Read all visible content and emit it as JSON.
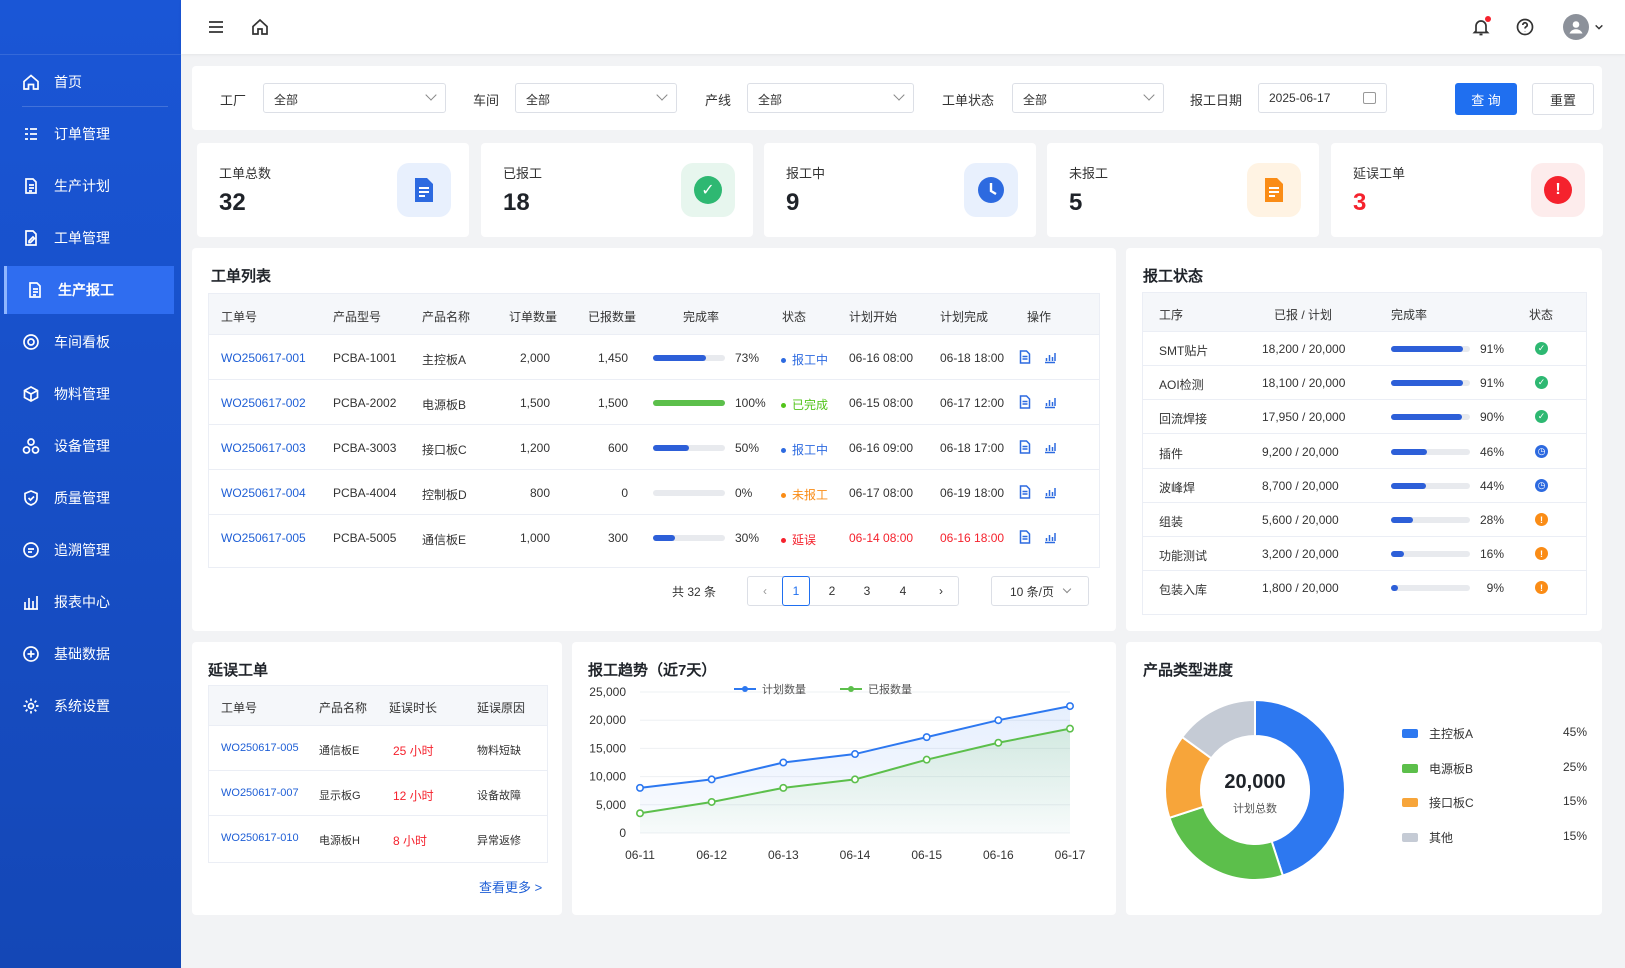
{
  "sidebar": {
    "items": [
      {
        "label": "首页",
        "icon": "home-icon"
      },
      {
        "label": "订单管理",
        "icon": "list-icon"
      },
      {
        "label": "生产计划",
        "icon": "document-icon"
      },
      {
        "label": "工单管理",
        "icon": "edit-document-icon"
      },
      {
        "label": "生产报工",
        "icon": "report-icon",
        "active": true
      },
      {
        "label": "车间看板",
        "icon": "target-icon"
      },
      {
        "label": "物料管理",
        "icon": "box-icon"
      },
      {
        "label": "设备管理",
        "icon": "device-icon"
      },
      {
        "label": "质量管理",
        "icon": "shield-icon"
      },
      {
        "label": "追溯管理",
        "icon": "trace-icon"
      },
      {
        "label": "报表中心",
        "icon": "bar-chart-icon"
      },
      {
        "label": "基础数据",
        "icon": "database-icon"
      },
      {
        "label": "系统设置",
        "icon": "gear-icon"
      }
    ]
  },
  "filters": {
    "factory_label": "工厂",
    "factory_value": "全部",
    "workshop_label": "车间",
    "workshop_value": "全部",
    "line_label": "产线",
    "line_value": "全部",
    "status_label": "工单状态",
    "status_value": "全部",
    "date_label": "报工日期",
    "date_value": "2025-06-17",
    "query_button": "查 询",
    "reset_button": "重置"
  },
  "stats": [
    {
      "label": "工单总数",
      "value": "32",
      "color": "#2d6ae0",
      "bg": "#e8f0fd"
    },
    {
      "label": "已报工",
      "value": "18",
      "color": "#2eb872",
      "bg": "#e7f6ee"
    },
    {
      "label": "报工中",
      "value": "9",
      "color": "#2d6ae0",
      "bg": "#e8f0fd"
    },
    {
      "label": "未报工",
      "value": "5",
      "color": "#fa8c16",
      "bg": "#fff3e3"
    },
    {
      "label": "延误工单",
      "value": "3",
      "color": "#f5222d",
      "bg": "#fdecec",
      "value_color": "#f5222d"
    }
  ],
  "work_orders": {
    "title": "工单列表",
    "headers": [
      "工单号",
      "产品型号",
      "产品名称",
      "订单数量",
      "已报数量",
      "完成率",
      "状态",
      "计划开始",
      "计划完成",
      "操作"
    ],
    "rows": [
      {
        "id": "WO250617-001",
        "model": "PCBA-1001",
        "name": "主控板A",
        "qty": "2,000",
        "reported": "1,450",
        "rate": "73%",
        "rate_num": 73,
        "status": "报工中",
        "status_color": "#2d6ae0",
        "start": "06-16 08:00",
        "end": "06-18 18:00",
        "late": false
      },
      {
        "id": "WO250617-002",
        "model": "PCBA-2002",
        "name": "电源板B",
        "qty": "1,500",
        "reported": "1,500",
        "rate": "100%",
        "rate_num": 100,
        "status": "已完成",
        "status_color": "#52c41a",
        "start": "06-15 08:00",
        "end": "06-17 12:00",
        "late": false
      },
      {
        "id": "WO250617-003",
        "model": "PCBA-3003",
        "name": "接口板C",
        "qty": "1,200",
        "reported": "600",
        "rate": "50%",
        "rate_num": 50,
        "status": "报工中",
        "status_color": "#2d6ae0",
        "start": "06-16 09:00",
        "end": "06-18 17:00",
        "late": false
      },
      {
        "id": "WO250617-004",
        "model": "PCBA-4004",
        "name": "控制板D",
        "qty": "800",
        "reported": "0",
        "rate": "0%",
        "rate_num": 0,
        "status": "未报工",
        "status_color": "#fa8c16",
        "start": "06-17 08:00",
        "end": "06-19 18:00",
        "late": false
      },
      {
        "id": "WO250617-005",
        "model": "PCBA-5005",
        "name": "通信板E",
        "qty": "1,000",
        "reported": "300",
        "rate": "30%",
        "rate_num": 30,
        "status": "延误",
        "status_color": "#f5222d",
        "start": "06-14 08:00",
        "end": "06-16 18:00",
        "late": true
      }
    ],
    "total_text": "共 32 条",
    "pages": [
      "1",
      "2",
      "3",
      "4"
    ],
    "page_size": "10 条/页"
  },
  "report_status": {
    "title": "报工状态",
    "headers": [
      "工序",
      "已报 / 计划",
      "完成率",
      "状态"
    ],
    "rows": [
      {
        "process": "SMT贴片",
        "ratio": "18,200 / 20,000",
        "rate": "91%",
        "rate_num": 91,
        "state": "done"
      },
      {
        "process": "AOI检测",
        "ratio": "18,100 / 20,000",
        "rate": "91%",
        "rate_num": 91,
        "state": "done"
      },
      {
        "process": "回流焊接",
        "ratio": "17,950 / 20,000",
        "rate": "90%",
        "rate_num": 90,
        "state": "done"
      },
      {
        "process": "插件",
        "ratio": "9,200 / 20,000",
        "rate": "46%",
        "rate_num": 46,
        "state": "progress"
      },
      {
        "process": "波峰焊",
        "ratio": "8,700 / 20,000",
        "rate": "44%",
        "rate_num": 44,
        "state": "progress"
      },
      {
        "process": "组装",
        "ratio": "5,600 / 20,000",
        "rate": "28%",
        "rate_num": 28,
        "state": "warn"
      },
      {
        "process": "功能测试",
        "ratio": "3,200 / 20,000",
        "rate": "16%",
        "rate_num": 16,
        "state": "warn"
      },
      {
        "process": "包装入库",
        "ratio": "1,800 / 20,000",
        "rate": "9%",
        "rate_num": 9,
        "state": "warn"
      }
    ]
  },
  "delayed": {
    "title": "延误工单",
    "headers": [
      "工单号",
      "产品名称",
      "延误时长",
      "延误原因"
    ],
    "rows": [
      {
        "id": "WO250617-005",
        "name": "通信板E",
        "delay": "25 小时",
        "reason": "物料短缺"
      },
      {
        "id": "WO250617-007",
        "name": "显示板G",
        "delay": "12 小时",
        "reason": "设备故障"
      },
      {
        "id": "WO250617-010",
        "name": "电源板H",
        "delay": "8 小时",
        "reason": "异常返修"
      }
    ],
    "more_link": "查看更多 >"
  },
  "trend": {
    "title": "报工趋势（近7天）"
  },
  "chart_data": {
    "type": "line",
    "x": [
      "06-11",
      "06-12",
      "06-13",
      "06-14",
      "06-15",
      "06-16",
      "06-17"
    ],
    "series": [
      {
        "name": "计划数量",
        "color": "#2d78f0",
        "values": [
          8000,
          9500,
          12500,
          14000,
          17000,
          20000,
          22500
        ]
      },
      {
        "name": "已报数量",
        "color": "#5cbf4b",
        "values": [
          3500,
          5500,
          8000,
          9500,
          13000,
          16000,
          18500
        ]
      }
    ],
    "y_ticks": [
      "25,000",
      "20,000",
      "15,000",
      "10,000",
      "5,000",
      "0"
    ],
    "ylim": [
      0,
      25000
    ],
    "legend": "top"
  },
  "product_progress": {
    "title": "产品类型进度",
    "center_value": "20,000",
    "center_label": "计划总数",
    "slices": [
      {
        "name": "主控板A",
        "pct": "45%",
        "value": 45,
        "color": "#2d78f0"
      },
      {
        "name": "电源板B",
        "pct": "25%",
        "value": 25,
        "color": "#5cbf4b"
      },
      {
        "name": "接口板C",
        "pct": "15%",
        "value": 15,
        "color": "#f7a53a"
      },
      {
        "name": "其他",
        "pct": "15%",
        "value": 15,
        "color": "#c5cbd5"
      }
    ]
  }
}
